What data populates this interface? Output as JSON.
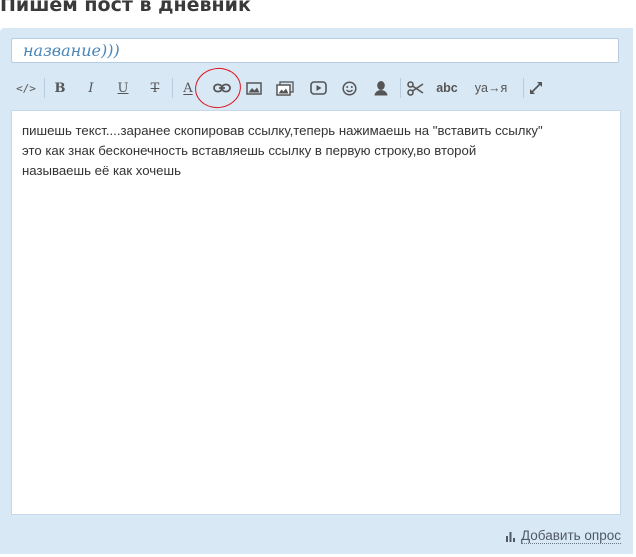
{
  "page": {
    "title": "Пишем пост в дневник"
  },
  "editor": {
    "title_value": "название)))",
    "body_lines": [
      "пишешь текст....заранее скопировав ссылку,теперь нажимаешь на \"вставить ссылку\"",
      "это как знак бесконечность вставляешь ссылку в первую строку,во второй",
      "называешь её как хочешь"
    ],
    "add_poll_label": "Добавить опрос"
  },
  "toolbar": {
    "source": "</>",
    "bold": "B",
    "italic": "I",
    "underline": "U",
    "strike": "T",
    "font_color": "A",
    "spellcheck": "abc",
    "translit": "ya→я",
    "icons": [
      "code-icon",
      "bold-icon",
      "italic-icon",
      "underline-icon",
      "strikethrough-icon",
      "font-color-icon",
      "link-icon",
      "image-icon",
      "gallery-icon",
      "video-icon",
      "smiley-icon",
      "user-icon",
      "cut-icon",
      "spellcheck-icon",
      "translit-icon",
      "fullscreen-icon"
    ]
  },
  "colors": {
    "panel_bg": "#d9e8f5",
    "title_text": "#4a86b8",
    "annotation": "#e0141e"
  }
}
